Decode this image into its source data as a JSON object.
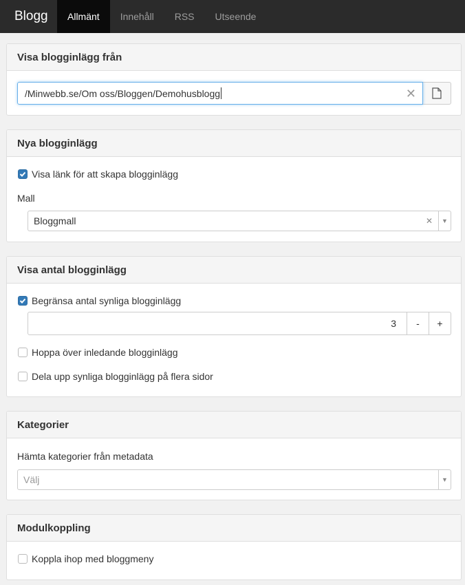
{
  "nav": {
    "brand": "Blogg",
    "tabs": [
      "Allmänt",
      "Innehåll",
      "RSS",
      "Utseende"
    ]
  },
  "source": {
    "title": "Visa blogginlägg från",
    "path_value": "/Minwebb.se/Om oss/Bloggen/Demohusblogg"
  },
  "new_posts": {
    "title": "Nya blogginlägg",
    "show_create_link_label": "Visa länk för att skapa blogginlägg",
    "show_create_link_checked": true,
    "template_label": "Mall",
    "template_value": "Bloggmall"
  },
  "count": {
    "title": "Visa antal blogginlägg",
    "limit_label": "Begränsa antal synliga blogginlägg",
    "limit_checked": true,
    "limit_value": "3",
    "decrement_label": "-",
    "increment_label": "+",
    "skip_label": "Hoppa över inledande blogginlägg",
    "skip_checked": false,
    "paginate_label": "Dela upp synliga blogginlägg på flera sidor",
    "paginate_checked": false
  },
  "categories": {
    "title": "Kategorier",
    "metadata_label": "Hämta kategorier från metadata",
    "select_placeholder": "Välj"
  },
  "module": {
    "title": "Modulkoppling",
    "link_menu_label": "Koppla ihop med bloggmeny",
    "link_menu_checked": false
  },
  "colors": {
    "navbar": "#2b2b2b",
    "nav_active": "#0b0b0b",
    "checkbox_checked": "#337ab7",
    "focus_border": "#66afe9"
  }
}
